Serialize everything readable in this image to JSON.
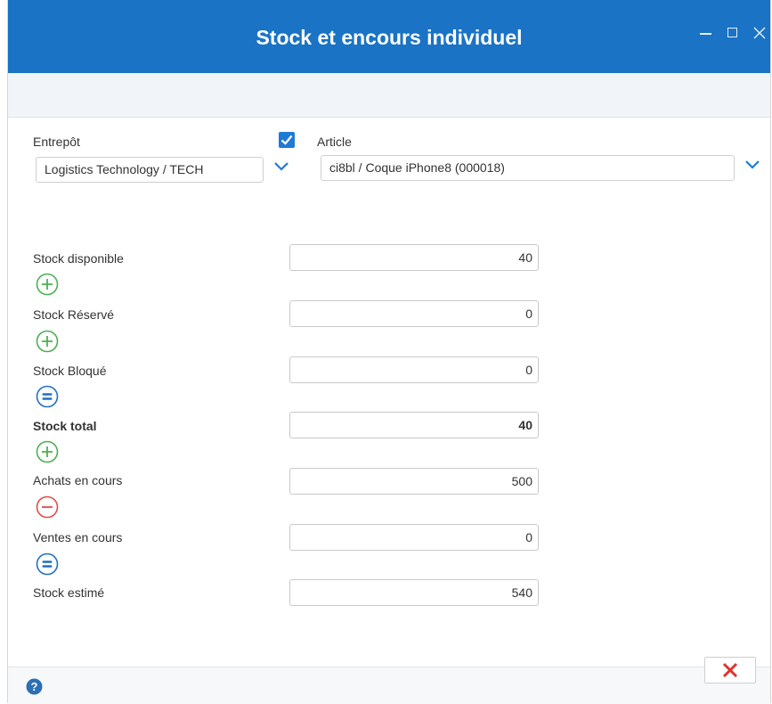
{
  "window": {
    "title": "Stock et encours individuel"
  },
  "filters": {
    "warehouse_label": "Entrepôt",
    "warehouse_value": "Logistics Technology / TECH",
    "article_label": "Article",
    "article_value": "ci8bl / Coque iPhone8 (000018)",
    "checkbox_checked": true
  },
  "stock_rows": [
    {
      "label": "Stock disponible",
      "value": "40",
      "operator_after": "plus-icon"
    },
    {
      "label": "Stock Réservé",
      "value": "0",
      "operator_after": "plus-icon"
    },
    {
      "label": "Stock Bloqué",
      "value": "0",
      "operator_after": "equals-icon"
    },
    {
      "label": "Stock total",
      "value": "40",
      "operator_after": "plus-icon"
    },
    {
      "label": "Achats en cours",
      "value": "500",
      "operator_after": "minus-icon"
    },
    {
      "label": "Ventes en cours",
      "value": "0",
      "operator_after": "equals-icon"
    },
    {
      "label": "Stock estimé",
      "value": "540",
      "operator_after": null
    }
  ],
  "colors": {
    "titlebar": "#1a73c4",
    "checkbox": "#1f7ad6",
    "plus": "#4caf50",
    "minus": "#e04b4b",
    "equals": "#1f6fc4",
    "close": "#e0312c"
  }
}
